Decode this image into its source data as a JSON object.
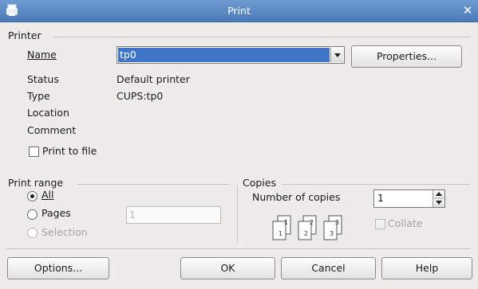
{
  "window": {
    "title": "Print",
    "close_glyph": "✕"
  },
  "printer": {
    "group_label": "Printer",
    "name_label": "Name",
    "name_value": "tp0",
    "properties_button": "Properties...",
    "status_label": "Status",
    "status_value": "Default printer",
    "type_label": "Type",
    "type_value": "CUPS:tp0",
    "location_label": "Location",
    "comment_label": "Comment",
    "print_to_file_label": "Print to file",
    "print_to_file_checked": false
  },
  "print_range": {
    "group_label": "Print range",
    "all_label": "All",
    "pages_label": "Pages",
    "pages_value": "1",
    "selection_label": "Selection",
    "selected": "all"
  },
  "copies": {
    "group_label": "Copies",
    "number_label": "Number of copies",
    "number_value": "1",
    "collate_label": "Collate",
    "collate_checked": false
  },
  "buttons": {
    "options": "Options...",
    "ok": "OK",
    "cancel": "Cancel",
    "help": "Help"
  },
  "icons": [
    "printer-app-icon",
    "close-icon",
    "dropdown-arrow-icon",
    "spin-up-icon",
    "spin-down-icon",
    "collate-sheets-icon"
  ]
}
